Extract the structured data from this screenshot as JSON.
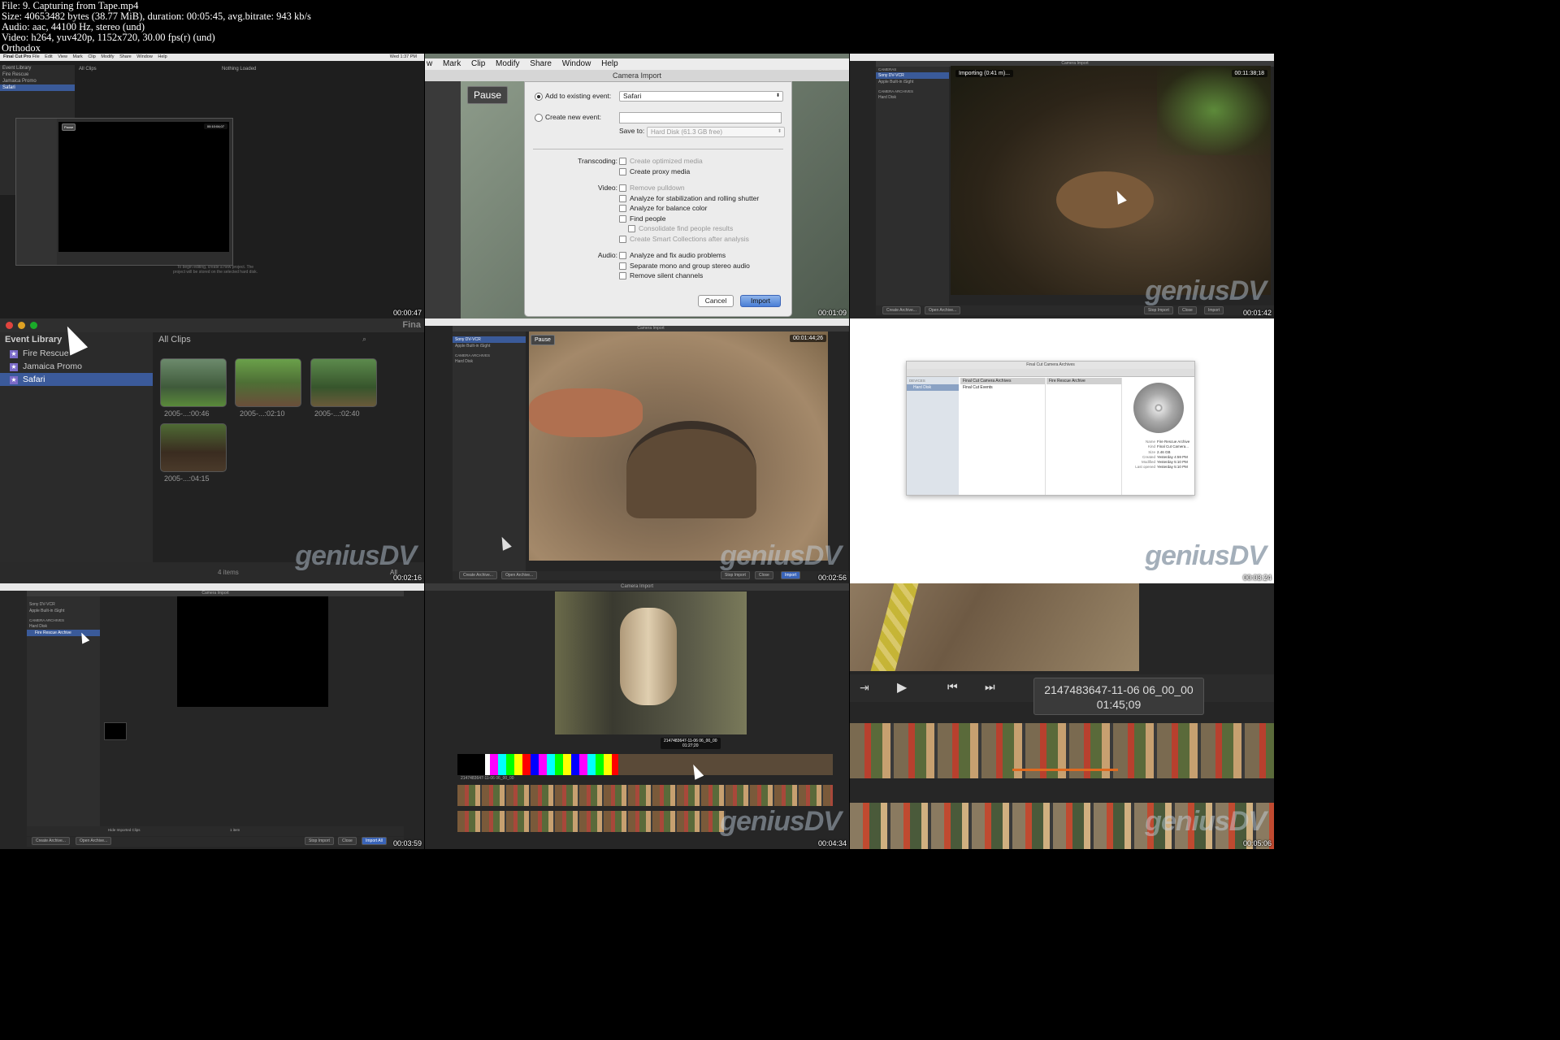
{
  "file_info": {
    "line1": "File: 9. Capturing from Tape.mp4",
    "line2": "Size: 40653482 bytes (38.77 MiB), duration: 00:05:45, avg.bitrate: 943 kb/s",
    "line3": "Audio: aac, 44100 Hz, stereo (und)",
    "line4": "Video: h264, yuv420p, 1152x720, 30.00 fps(r) (und)",
    "line5": "Orthodox"
  },
  "watermark": "geniusDV",
  "tiles": [
    {
      "timestamp": "00:00:47",
      "menu": [
        "Final Cut Pro",
        "File",
        "Edit",
        "View",
        "Mark",
        "Clip",
        "Modify",
        "Share",
        "Window",
        "Help"
      ],
      "clock": "Wed 1:37 PM",
      "library_title": "Event Library",
      "library_items": [
        "Fire Rescue",
        "Jamaica Promo",
        "Safari"
      ],
      "all_clips": "All Clips",
      "nothing_loaded": "Nothing Loaded",
      "pause": "Pause",
      "timecode": "00:10:04;07",
      "hint": "To begin editing, create a new project. The project will be stored on the selected hard disk."
    },
    {
      "timestamp": "00:01:09",
      "menu": [
        "w",
        "Mark",
        "Clip",
        "Modify",
        "Share",
        "Window",
        "Help"
      ],
      "dialog_title": "Camera Import",
      "pause": "Pause",
      "add_existing": "Add to existing event:",
      "existing_value": "Safari",
      "create_new": "Create new event:",
      "save_to": "Save to:",
      "save_to_value": "Hard Disk  (61.3 GB free)",
      "transcoding_label": "Transcoding:",
      "transcoding": [
        "Create optimized media",
        "Create proxy media"
      ],
      "video_label": "Video:",
      "video": [
        "Remove pulldown",
        "Analyze for stabilization and rolling shutter",
        "Analyze for balance color",
        "Find people",
        "Consolidate find people results",
        "Create Smart Collections after analysis"
      ],
      "audio_label": "Audio:",
      "audio": [
        "Analyze and fix audio problems",
        "Separate mono and group stereo audio",
        "Remove silent channels"
      ],
      "cancel": "Cancel",
      "import": "Import"
    },
    {
      "timestamp": "00:01:42",
      "title": "Camera Import",
      "cameras_label": "CAMERAS",
      "cameras": [
        "Sony DV-VCR",
        "Apple Built-in iSight"
      ],
      "archives_label": "CAMERA ARCHIVES",
      "archives": [
        "Hard Disk"
      ],
      "importing": "Importing (0:41 m)...",
      "timecode": "00:11:38;18",
      "buttons": [
        "Create Archive...",
        "Open Archive...",
        "Stop Import",
        "Close",
        "Import"
      ]
    },
    {
      "timestamp": "00:02:16",
      "library_title": "Event Library",
      "library_items": [
        "Fire Rescue",
        "Jamaica Promo",
        "Safari"
      ],
      "app_title": "Fina",
      "all_clips": "All Clips",
      "clips": [
        "2005-...:00:46",
        "2005-...:02:10",
        "2005-...:02:40",
        "2005-...:04:15"
      ],
      "count": "4 items",
      "filter": "All"
    },
    {
      "timestamp": "00:02:56",
      "title": "Camera Import",
      "cameras": [
        "Sony DV-VCR",
        "Apple Built-in iSight"
      ],
      "archives_label": "CAMERA ARCHIVES",
      "archives": [
        "Hard Disk"
      ],
      "pause": "Pause",
      "timecode": "00:01:44;26",
      "buttons": [
        "Create Archive...",
        "Open Archive...",
        "Stop Import",
        "Close",
        "Import"
      ]
    },
    {
      "timestamp": "00:03:24",
      "window_title": "Final Cut Camera Archives",
      "devices_label": "DEVICES",
      "devices": [
        "Hard Disk"
      ],
      "col1": [
        "Final Cut Camera Archives",
        "Final Cut Events"
      ],
      "col2": [
        "Fire Rescue Archive"
      ],
      "info_keys": [
        "Name",
        "Kind",
        "Size",
        "Created",
        "Modified",
        "Last opened"
      ],
      "info_vals": [
        "Fire Rescue Archive",
        "Final Cut Camera...",
        "2.46 GB",
        "Yesterday 4:59 PM",
        "Yesterday 5:10 PM",
        "Yesterday 5:10 PM"
      ]
    },
    {
      "timestamp": "00:03:59",
      "title": "Camera Import",
      "cameras": [
        "Sony DV-VCR",
        "Apple Built-in iSight"
      ],
      "archives_label": "CAMERA ARCHIVES",
      "archives": [
        "Hard Disk",
        "Fire Rescue Archive"
      ],
      "hide_imported": "Hide Imported Clips",
      "count": "1 item",
      "buttons": [
        "Create Archive...",
        "Open Archive...",
        "Stop Import",
        "Close",
        "Import All"
      ]
    },
    {
      "timestamp": "00:04:34",
      "title": "Camera Import",
      "pause": "Pause",
      "range_label": "2147483647-11-06 06_00_00",
      "range_sub": "01:27;20",
      "strip_label": "2147483647-11-06 06_00_00"
    },
    {
      "timestamp": "00:05:06",
      "tooltip_line1": "2147483647-11-06 06_00_00",
      "tooltip_line2": "01:45;09"
    }
  ]
}
